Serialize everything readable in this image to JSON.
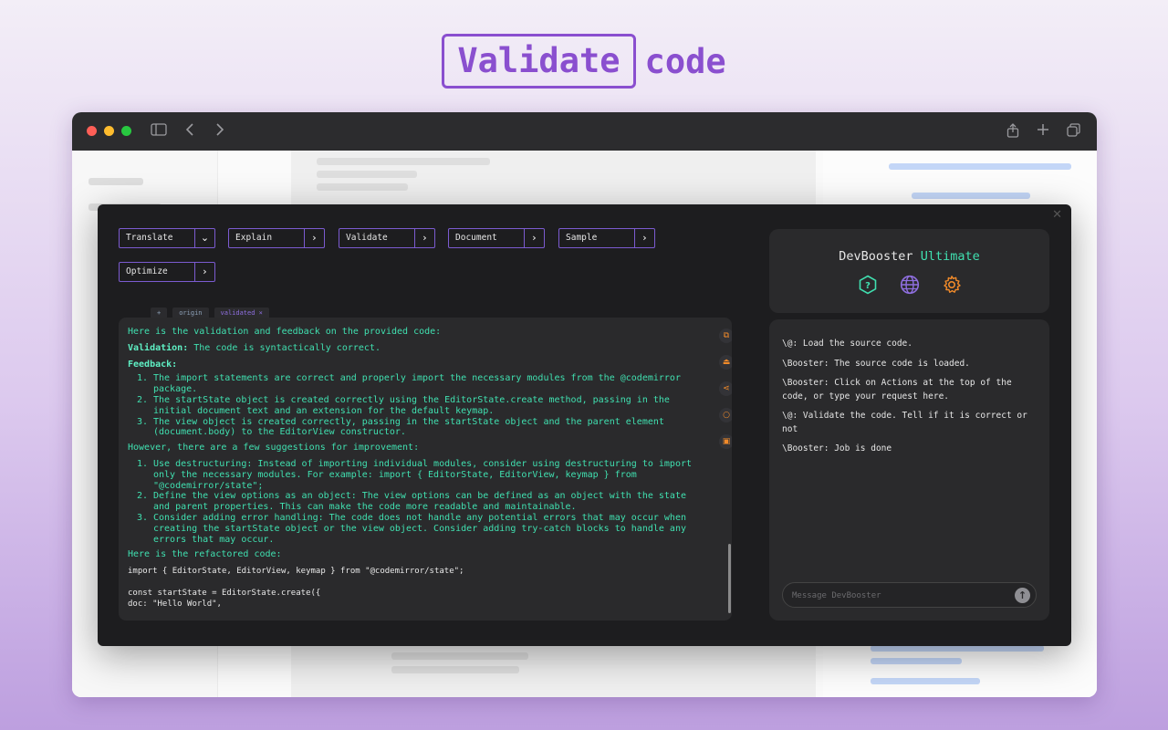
{
  "hero": {
    "boxed": "Validate",
    "word": "code"
  },
  "actions": [
    {
      "label": "Translate",
      "chevron": "⌄"
    },
    {
      "label": "Explain",
      "chevron": "›"
    },
    {
      "label": "Validate",
      "chevron": "›"
    },
    {
      "label": "Document",
      "chevron": "›"
    },
    {
      "label": "Sample",
      "chevron": "›"
    },
    {
      "label": "Optimize",
      "chevron": "›"
    }
  ],
  "tabs": [
    "+",
    "origin",
    "validated ×"
  ],
  "output": {
    "intro": "Here is the validation and feedback on the provided code:",
    "validation_label": "Validation:",
    "validation_text": "The code is syntactically correct.",
    "feedback_label": "Feedback:",
    "feedback": [
      "The import statements are correct and properly import the necessary modules from the @codemirror package.",
      "The startState object is created correctly using the EditorState.create method, passing in the initial document text and an extension for the default keymap.",
      "The view object is created correctly, passing in the startState object and the parent element (document.body) to the EditorView constructor."
    ],
    "suggestions_intro": "However, there are a few suggestions for improvement:",
    "suggestions": [
      "Use destructuring: Instead of importing individual modules, consider using destructuring to import only the necessary modules. For example: import { EditorState, EditorView, keymap } from \"@codemirror/state\";",
      "Define the view options as an object: The view options can be defined as an object with the state and parent properties. This can make the code more readable and maintainable.",
      "Consider adding error handling: The code does not handle any potential errors that may occur when creating the startState object or the view object. Consider adding try-catch blocks to handle any errors that may occur."
    ],
    "refactor_intro": "Here is the refactored code:",
    "code_lines": [
      "import { EditorState, EditorView, keymap } from \"@codemirror/state\";",
      "",
      "const startState = EditorState.create({",
      "  doc: \"Hello World\","
    ]
  },
  "output_tools": [
    "copy-icon",
    "insert-icon",
    "share-icon",
    "comment-icon",
    "save-icon"
  ],
  "brand": {
    "name": "DevBooster",
    "tier": "Ultimate"
  },
  "chat": {
    "messages": [
      "\\@: Load the source code.",
      "\\Booster: The source code is loaded.",
      "\\Booster: Click on Actions at the top of the code, or type your request here.",
      "\\@: Validate the code. Tell if it is correct or not",
      "\\Booster: Job is done"
    ],
    "placeholder": "Message DevBooster"
  },
  "colors": {
    "accent": "#8a4fcf",
    "teal": "#40e0b0",
    "orange": "#f08a2a",
    "purple": "#8f6fe0"
  }
}
